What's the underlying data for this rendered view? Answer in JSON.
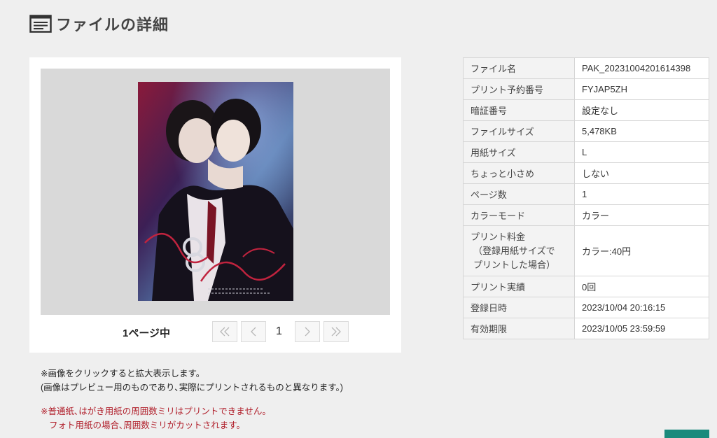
{
  "page": {
    "title": "ファイルの詳細"
  },
  "preview": {
    "page_count_label": "1ページ中",
    "current_page": "1",
    "buttons": {
      "first": "«",
      "prev": "‹",
      "next": "›",
      "last": "»"
    }
  },
  "details": [
    {
      "label": "ファイル名",
      "value": "PAK_20231004201614398"
    },
    {
      "label": "プリント予約番号",
      "value": "FYJAP5ZH"
    },
    {
      "label": "暗証番号",
      "value": "設定なし"
    },
    {
      "label": "ファイルサイズ",
      "value": "5,478KB"
    },
    {
      "label": "用紙サイズ",
      "value": "L"
    },
    {
      "label": "ちょっと小さめ",
      "value": "しない"
    },
    {
      "label": "ページ数",
      "value": "1"
    },
    {
      "label": "カラーモード",
      "value": "カラー"
    },
    {
      "label": "プリント料金",
      "label_sub1": "（登録用紙サイズで",
      "label_sub2": "プリントした場合）",
      "value": "カラー:40円"
    },
    {
      "label": "プリント実績",
      "value": "0回"
    },
    {
      "label": "登録日時",
      "value": "2023/10/04 20:16:15"
    },
    {
      "label": "有効期限",
      "value": "2023/10/05 23:59:59"
    }
  ],
  "notes": {
    "line1": "※画像をクリックすると拡大表示します。",
    "line2": "(画像はプレビュー用のものであり､実際にプリントされるものと異なります。)",
    "warn1": "※普通紙､はがき用紙の周囲数ミリはプリントできません。",
    "warn2": "フォト用紙の場合､周囲数ミリがカットされます。"
  },
  "colors": {
    "accent": "#1a8a7c",
    "warning": "#b01e2a"
  }
}
